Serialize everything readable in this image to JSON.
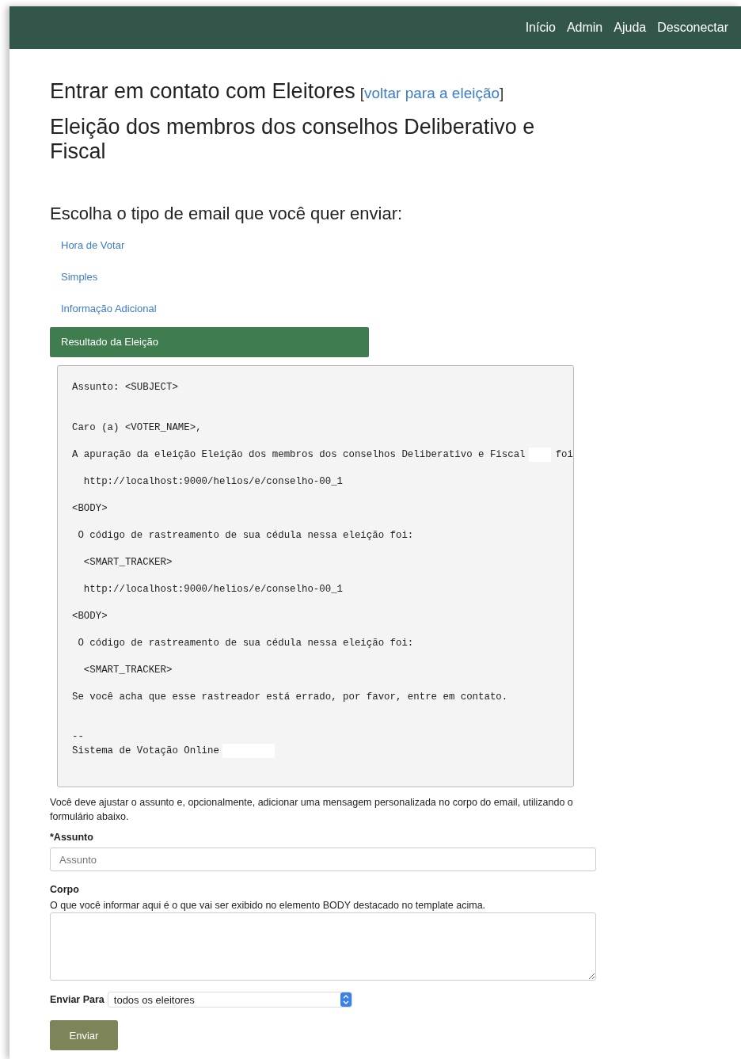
{
  "nav": {
    "links": [
      "Início",
      "Admin",
      "Ajuda",
      "Desconectar"
    ]
  },
  "title": "Entrar em contato com Eleitores",
  "back_link": {
    "open_bracket": "[",
    "label": "voltar para a eleição",
    "close_bracket": "]"
  },
  "election_name": "Eleição dos membros dos conselhos Deliberativo e Fiscal",
  "choose_heading": "Escolha o tipo de email que você quer enviar:",
  "email_types": [
    {
      "label": "Hora de Votar",
      "selected": false
    },
    {
      "label": "Simples",
      "selected": false
    },
    {
      "label": "Informação Adicional",
      "selected": false
    },
    {
      "label": "Resultado da Eleição",
      "selected": true
    }
  ],
  "template": [
    {
      "lines": [
        {
          "text": "Assunto: <SUBJECT>"
        }
      ]
    },
    {
      "lines": [
        {
          "text": "Caro (a) <VOTER_NAME>,"
        }
      ]
    },
    {
      "lines": [
        {
          "text": "A apuração da eleição Eleição dos membros dos conselhos Deliberativo e Fiscal",
          "redacted": true,
          "after": "foi"
        }
      ]
    },
    {
      "lines": [
        {
          "text": "  http://localhost:9000/helios/e/conselho-00_1"
        }
      ]
    },
    {
      "lines": [
        {
          "text": "<BODY>"
        }
      ]
    },
    {
      "lines": [
        {
          "text": " O código de rastreamento de sua cédula nessa eleição foi:"
        }
      ]
    },
    {
      "lines": [
        {
          "text": "  <SMART_TRACKER>"
        }
      ]
    },
    {
      "lines": [
        {
          "text": "  http://localhost:9000/helios/e/conselho-00_1"
        }
      ]
    },
    {
      "lines": [
        {
          "text": "<BODY>"
        }
      ]
    },
    {
      "lines": [
        {
          "text": " O código de rastreamento de sua cédula nessa eleição foi:"
        }
      ]
    },
    {
      "lines": [
        {
          "text": "  <SMART_TRACKER>"
        }
      ]
    },
    {
      "lines": [
        {
          "text": "Se você acha que esse rastreador está errado, por favor, entre em contato."
        }
      ]
    },
    {
      "lines": [
        {
          "text": "--"
        },
        {
          "text": "Sistema de Votação Online",
          "redacted": true
        }
      ]
    }
  ],
  "instructions": "Você deve ajustar o assunto e, opcionalmente, adicionar uma mensagem personalizada no corpo do email, utilizando o formulário abaixo.",
  "subject": {
    "label": "*Assunto",
    "placeholder": "Assunto"
  },
  "body": {
    "label": "Corpo",
    "help": "O que você informar aqui é o que vai ser exibido no elemento BODY destacado no template acima."
  },
  "send_to": {
    "label": "Enviar Para",
    "value": "todos os eleitores"
  },
  "submit": "Enviar"
}
